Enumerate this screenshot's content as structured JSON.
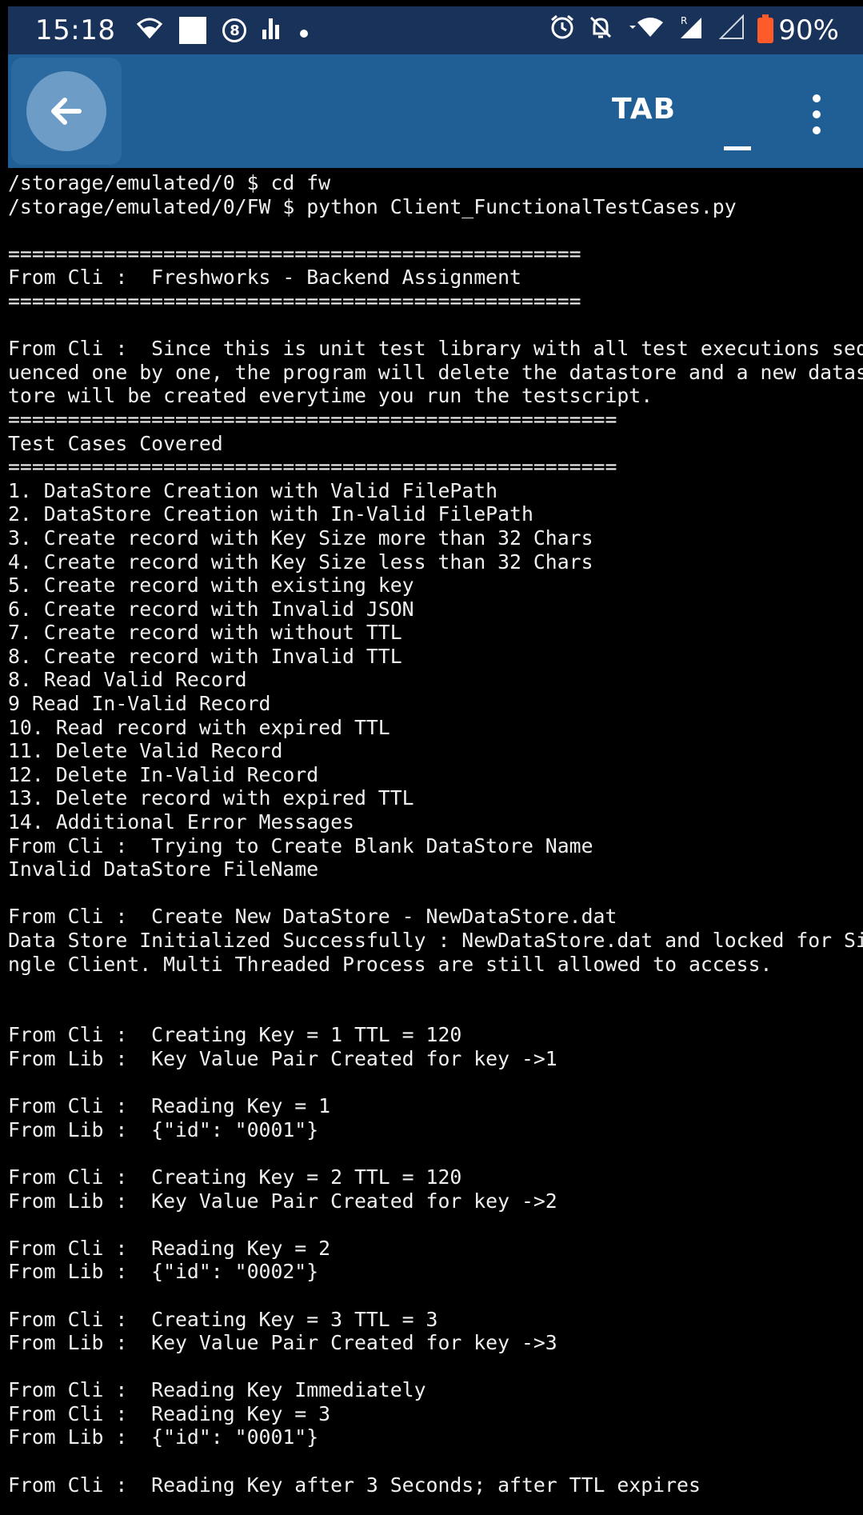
{
  "status_bar": {
    "time": "15:18",
    "left_icons": [
      "wifi-icon",
      "white-square-icon",
      "circled-8-icon",
      "signal-bars-icon",
      "dot-icon"
    ],
    "circled_number": "8",
    "battery": "90%",
    "right_icons": [
      "alarm-icon",
      "muted-bell-icon",
      "wifi-full-icon",
      "signal-roaming-icon",
      "signal-empty-icon",
      "battery-icon"
    ],
    "battery_color": "#ff5a2a"
  },
  "app_bar": {
    "title": "TAB",
    "background": "#1f5f96"
  },
  "terminal": {
    "lines": [
      "/storage/emulated/0 $ cd fw",
      "/storage/emulated/0/FW $ python Client_FunctionalTestCases.py",
      "",
      "================================================",
      "From Cli :  Freshworks - Backend Assignment",
      "================================================",
      "",
      "From Cli :  Since this is unit test library with all test executions seq",
      "uenced one by one, the program will delete the datastore and a new datas",
      "tore will be created everytime you run the testscript.",
      "===================================================",
      "Test Cases Covered",
      "===================================================",
      "1. DataStore Creation with Valid FilePath",
      "2. DataStore Creation with In-Valid FilePath",
      "3. Create record with Key Size more than 32 Chars",
      "4. Create record with Key Size less than 32 Chars",
      "5. Create record with existing key",
      "6. Create record with Invalid JSON",
      "7. Create record with without TTL",
      "8. Create record with Invalid TTL",
      "8. Read Valid Record",
      "9 Read In-Valid Record",
      "10. Read record with expired TTL",
      "11. Delete Valid Record",
      "12. Delete In-Valid Record",
      "13. Delete record with expired TTL",
      "14. Additional Error Messages",
      "From Cli :  Trying to Create Blank DataStore Name",
      "Invalid DataStore FileName",
      "",
      "From Cli :  Create New DataStore - NewDataStore.dat",
      "Data Store Initialized Successfully : NewDataStore.dat and locked for Si",
      "ngle Client. Multi Threaded Process are still allowed to access.",
      "",
      "",
      "From Cli :  Creating Key = 1 TTL = 120",
      "From Lib :  Key Value Pair Created for key ->1",
      "",
      "From Cli :  Reading Key = 1",
      "From Lib :  {\"id\": \"0001\"}",
      "",
      "From Cli :  Creating Key = 2 TTL = 120",
      "From Lib :  Key Value Pair Created for key ->2",
      "",
      "From Cli :  Reading Key = 2",
      "From Lib :  {\"id\": \"0002\"}",
      "",
      "From Cli :  Creating Key = 3 TTL = 3",
      "From Lib :  Key Value Pair Created for key ->3",
      "",
      "From Cli :  Reading Key Immediately",
      "From Cli :  Reading Key = 3",
      "From Lib :  {\"id\": \"0001\"}",
      "",
      "From Cli :  Reading Key after 3 Seconds; after TTL expires"
    ]
  }
}
